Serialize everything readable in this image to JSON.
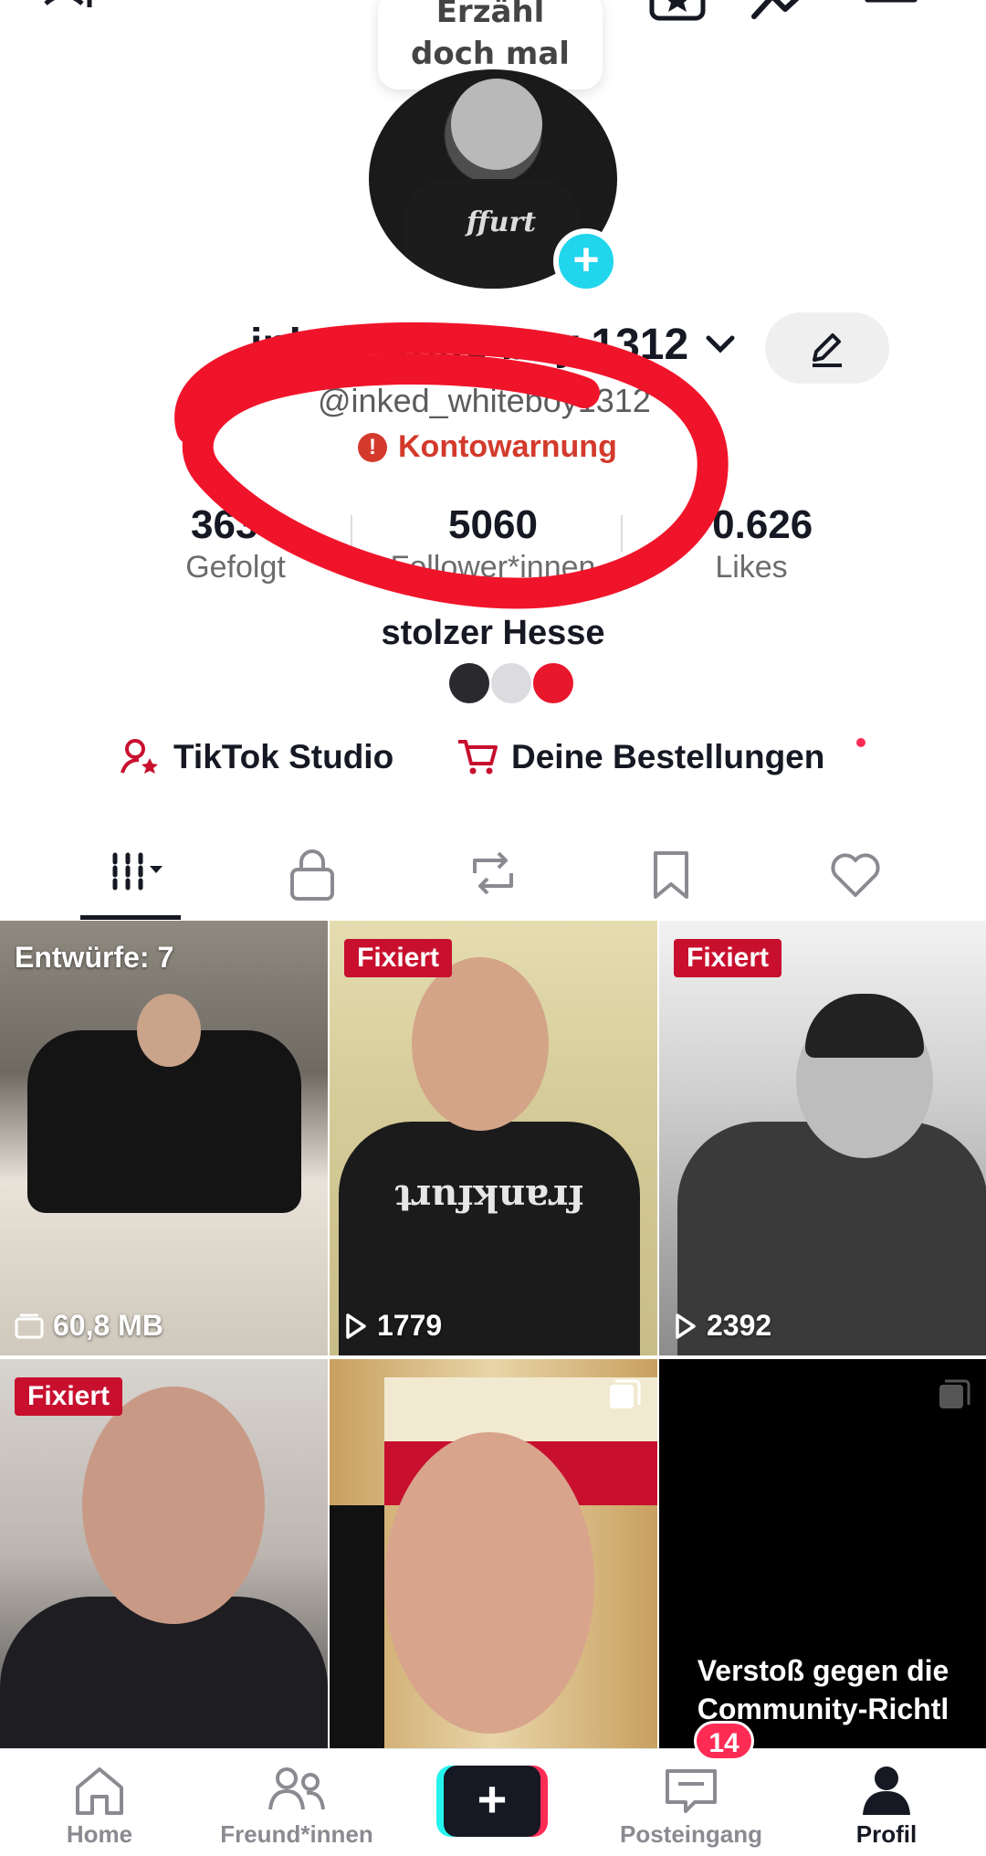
{
  "top_bar": {
    "add_friend_icon": "add-user-icon",
    "prompt_bubble": [
      "Erzähl",
      "doch mal"
    ],
    "icons": [
      "creator-badge-icon",
      "analytics-icon",
      "menu-icon"
    ]
  },
  "profile": {
    "display_name": "inked white boy 1312",
    "handle": "@inked_whiteboy1312",
    "warning": "Kontowarnung",
    "stats": [
      {
        "value": "3636",
        "label": "Gefolgt"
      },
      {
        "value": "5060",
        "label": "Follower*innen"
      },
      {
        "value": "70.626",
        "label": "Likes"
      }
    ],
    "bio": "stolzer Hesse",
    "bio_dot_colors": [
      "#2a2a2e",
      "#dcdce0",
      "#e8172c"
    ]
  },
  "links": {
    "studio": "TikTok Studio",
    "orders": "Deine Bestellungen"
  },
  "tabs": [
    "videos",
    "private",
    "reposts",
    "favorites",
    "liked"
  ],
  "grid": [
    {
      "type": "draft",
      "label": "Entwürfe: 7",
      "meta": "60,8 MB"
    },
    {
      "type": "pinned",
      "badge": "Fixiert",
      "views": "1779"
    },
    {
      "type": "pinned",
      "badge": "Fixiert",
      "views": "2392"
    },
    {
      "type": "pinned",
      "badge": "Fixiert"
    },
    {
      "type": "photo"
    },
    {
      "type": "violation",
      "text_lines": [
        "Verstoß gegen die",
        "Community-Richtl"
      ]
    }
  ],
  "bottom_nav": {
    "home": "Home",
    "friends": "Freund*innen",
    "inbox": "Posteingang",
    "inbox_badge": "14",
    "profile": "Profil"
  },
  "colors": {
    "accent_red": "#fe2c55",
    "accent_cyan": "#25f4ee",
    "warning": "#d33a2c",
    "pinned_badge": "#c8102e",
    "annotation": "#f0142a"
  }
}
